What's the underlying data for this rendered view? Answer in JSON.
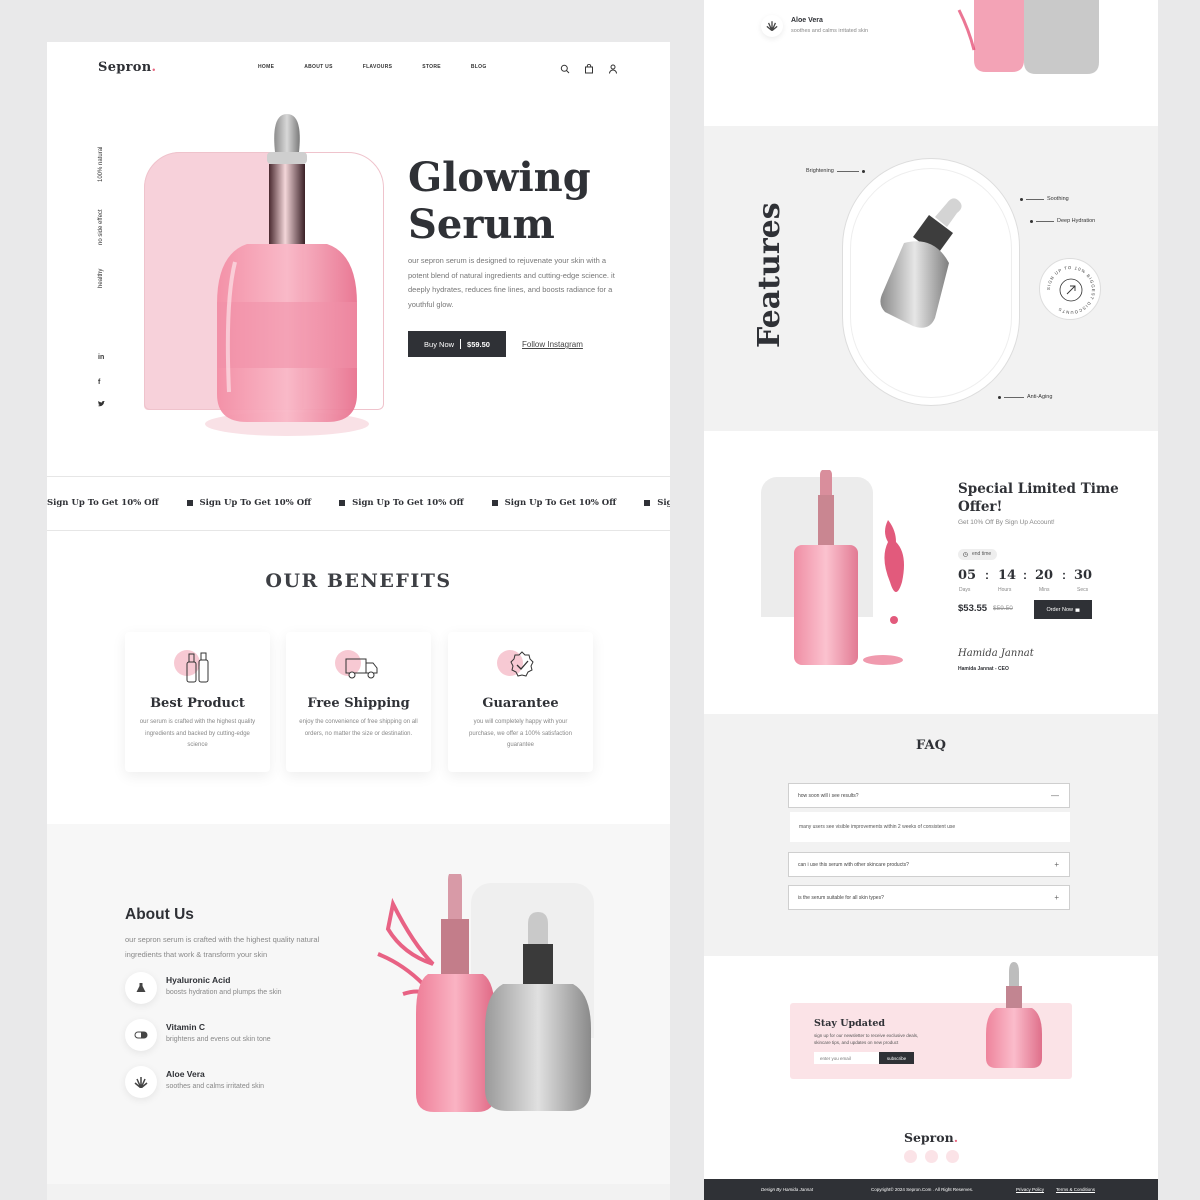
{
  "brand": {
    "name": "Sepron",
    "dot": ".",
    "accent": "#e8647e",
    "dark": "#2f3136",
    "pink": "#f7c9d3"
  },
  "nav": {
    "links": [
      "HOME",
      "ABOUT US",
      "FLAVOURS",
      "STORE",
      "BLOG"
    ],
    "icons": [
      "search-icon",
      "shopping-bag-icon",
      "user-icon"
    ]
  },
  "hero": {
    "side_labels": [
      "100% natural",
      "no side effect",
      "healthy"
    ],
    "social": [
      "in",
      "f",
      "twitter-icon"
    ],
    "title_line1": "Glowing",
    "title_line2": "Serum",
    "description": "our sepron serum is designed to rejuvenate your skin with a potent blend of natural ingredients and cutting-edge science. it deeply hydrates, reduces fine lines, and boosts radiance for a youthful glow.",
    "buy_label": "Buy Now",
    "buy_price": "$59.50",
    "follow_label": "Follow Instagram"
  },
  "marquee": {
    "items": [
      "Sign Up To Get 10% Off",
      "Sign Up To Get 10% Off",
      "Sign Up To Get 10% Off",
      "Sign Up To Get 10% Off",
      "Sign Up To Get 10% Off"
    ]
  },
  "benefits": {
    "title": "OUR BENEFITS",
    "cards": [
      {
        "title": "Best Product",
        "desc": "our serum is crafted with the highest quality ingredients and backed by cutting-edge science",
        "icon": "bottles-icon"
      },
      {
        "title": "Free Shipping",
        "desc": "enjoy the convenience of free shipping on all orders, no matter the size or destination.",
        "icon": "truck-icon"
      },
      {
        "title": "Guarantee",
        "desc": "you will completely happy with your purchase, we offer a 100% satisfaction guarantee",
        "icon": "badge-check-icon"
      }
    ]
  },
  "about": {
    "title": "About Us",
    "desc": "our sepron serum is crafted with the highest quality natural ingredients that work & transform your skin",
    "ingredients": [
      {
        "name": "Hyaluronic Acid",
        "desc": "boosts hydration and plumps the skin",
        "icon": "flask-icon"
      },
      {
        "name": "Vitamin C",
        "desc": "brightens and evens out skin tone",
        "icon": "capsule-icon"
      },
      {
        "name": "Aloe Vera",
        "desc": "soothes and calms irritated skin",
        "icon": "aloe-icon"
      }
    ]
  },
  "right_top": {
    "name": "Aloe Vera",
    "desc": "soothes and calms irritated skin"
  },
  "features": {
    "title": "Features",
    "labels": [
      "Brightening",
      "Soothing",
      "Deep Hydration",
      "Anti-Aging"
    ],
    "badge_text": "SIGN UP TO 10% BIGGEST DISCOUNTS"
  },
  "offer": {
    "title": "Special Limited Time Offer!",
    "subtitle": "Get 10% Off By Sign Up Account!",
    "end_label": "end time",
    "countdown": [
      {
        "value": "05",
        "unit": "Days"
      },
      {
        "value": "14",
        "unit": "Hours"
      },
      {
        "value": "20",
        "unit": "Mins"
      },
      {
        "value": "30",
        "unit": "Secs"
      }
    ],
    "price": "$53.55",
    "old_price": "$59.50",
    "order_label": "Order Now",
    "signature": "Hamida Jannat",
    "signer": "Hamida Jannat - CEO"
  },
  "faq": {
    "title": "FAQ",
    "items": [
      {
        "q": "how soon will i see results?",
        "toggle": "—"
      },
      {
        "q": "can i use this serum with other skincare products?",
        "toggle": "+"
      },
      {
        "q": "is the serum suitable for all skin types?",
        "toggle": "+"
      }
    ],
    "answer": "many users see visible improvements within 2 weeks of consistent use"
  },
  "newsletter": {
    "title": "Stay Updated",
    "desc": "sign up for our newsletter to receive exclusive deals, skincare tips, and updates on new product",
    "placeholder": "enter you email",
    "button": "subscribe"
  },
  "footer": {
    "logo": "Sepron",
    "design_by": "Design By Hamida Jannat",
    "copyright": "Copyright© 2024 Sepron.Com . All Right Reserves.",
    "privacy": "Privacy Policy",
    "terms": "Terms & Conditions"
  }
}
